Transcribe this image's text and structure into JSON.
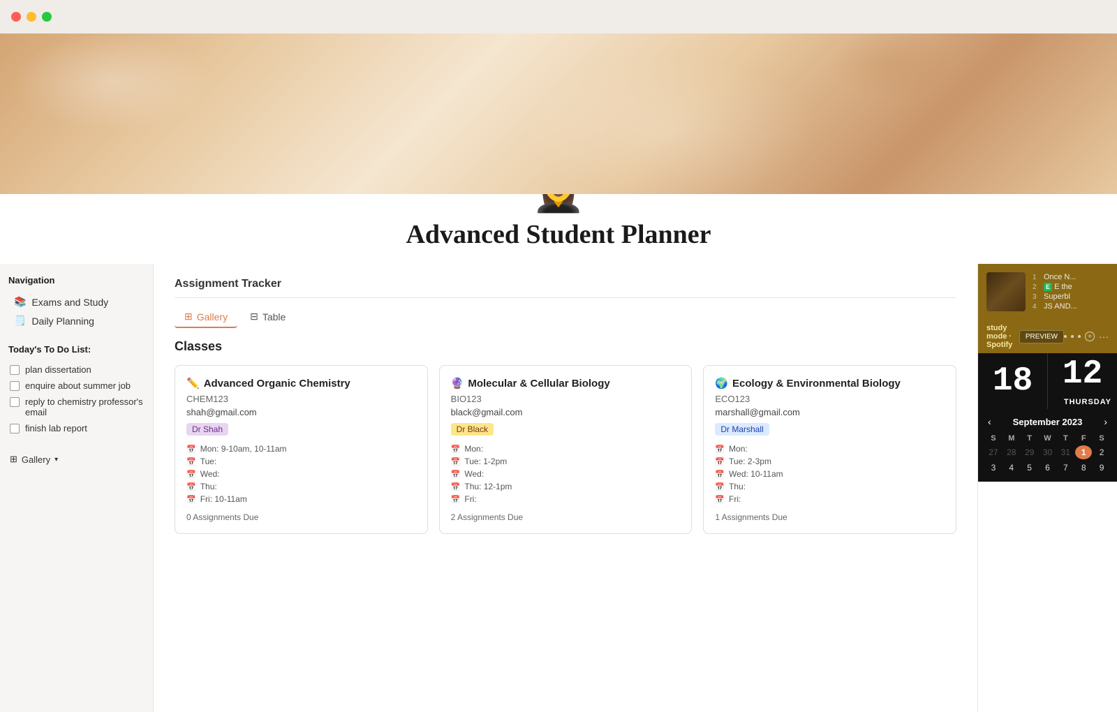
{
  "titlebar": {
    "buttons": [
      "close",
      "minimize",
      "maximize"
    ]
  },
  "hero": {
    "emoji": "👩‍🎓",
    "title": "Advanced Student Planner"
  },
  "sidebar": {
    "nav_title": "Navigation",
    "nav_items": [
      {
        "icon": "📚",
        "label": "Exams and Study"
      },
      {
        "icon": "🗒️",
        "label": "Daily Planning"
      }
    ],
    "todo_title": "Today's To Do List:",
    "todo_items": [
      {
        "label": "plan dissertation",
        "checked": false
      },
      {
        "label": "enquire about summer job",
        "checked": false
      },
      {
        "label": "reply to chemistry professor's email",
        "checked": false
      },
      {
        "label": "finish lab report",
        "checked": false
      }
    ],
    "gallery_label": "Gallery"
  },
  "main": {
    "tracker_title": "Assignment Tracker",
    "tabs": [
      {
        "label": "Gallery",
        "icon": "⊞",
        "active": true
      },
      {
        "label": "Table",
        "icon": "⊟",
        "active": false
      }
    ],
    "classes_title": "Classes",
    "classes": [
      {
        "icon": "✏️",
        "title": "Advanced Organic Chemistry",
        "code": "CHEM123",
        "email": "shah@gmail.com",
        "professor": "Dr Shah",
        "professor_color": "shah",
        "schedule": [
          {
            "day": "Mon:",
            "time": "9-10am, 10-11am"
          },
          {
            "day": "Tue:",
            "time": ""
          },
          {
            "day": "Wed:",
            "time": ""
          },
          {
            "day": "Thu:",
            "time": ""
          },
          {
            "day": "Fri:",
            "time": "10-11am"
          }
        ],
        "assignments_due": "0 Assignments Due"
      },
      {
        "icon": "🔮",
        "title": "Molecular & Cellular Biology",
        "code": "BIO123",
        "email": "black@gmail.com",
        "professor": "Dr Black",
        "professor_color": "black",
        "schedule": [
          {
            "day": "Mon:",
            "time": ""
          },
          {
            "day": "Tue:",
            "time": "1-2pm"
          },
          {
            "day": "Wed:",
            "time": ""
          },
          {
            "day": "Thu:",
            "time": "12-1pm"
          },
          {
            "day": "Fri:",
            "time": ""
          }
        ],
        "assignments_due": "2 Assignments Due"
      },
      {
        "icon": "🌍",
        "title": "Ecology & Environmental Biology",
        "code": "ECO123",
        "email": "marshall@gmail.com",
        "professor": "Dr Marshall",
        "professor_color": "marshall",
        "schedule": [
          {
            "day": "Mon:",
            "time": ""
          },
          {
            "day": "Tue:",
            "time": "2-3pm"
          },
          {
            "day": "Wed:",
            "time": "10-11am"
          },
          {
            "day": "Thu:",
            "time": ""
          },
          {
            "day": "Fri:",
            "time": ""
          }
        ],
        "assignments_due": "1 Assignments Due"
      }
    ]
  },
  "spotify": {
    "title": "study mode · Spotify",
    "tracks": [
      {
        "num": "1",
        "name": "Once N..."
      },
      {
        "num": "2",
        "name": "E the"
      },
      {
        "num": "3",
        "name": "Superbl"
      },
      {
        "num": "4",
        "name": "JS AND..."
      }
    ],
    "preview_label": "PREVIEW",
    "controls": [
      "◀◀",
      "▶",
      "▶▶"
    ]
  },
  "clock": {
    "hour": "18",
    "minute": "12",
    "day_label": "THURSDAY"
  },
  "calendar": {
    "title": "September 2023",
    "day_headers": [
      "S",
      "M",
      "T",
      "W",
      "T",
      "F",
      "S"
    ],
    "weeks": [
      [
        "27",
        "28",
        "29",
        "30",
        "31",
        "1",
        "2"
      ],
      [
        "3",
        "4",
        "5",
        "6",
        "7",
        "8",
        "9"
      ]
    ],
    "today": "1"
  }
}
